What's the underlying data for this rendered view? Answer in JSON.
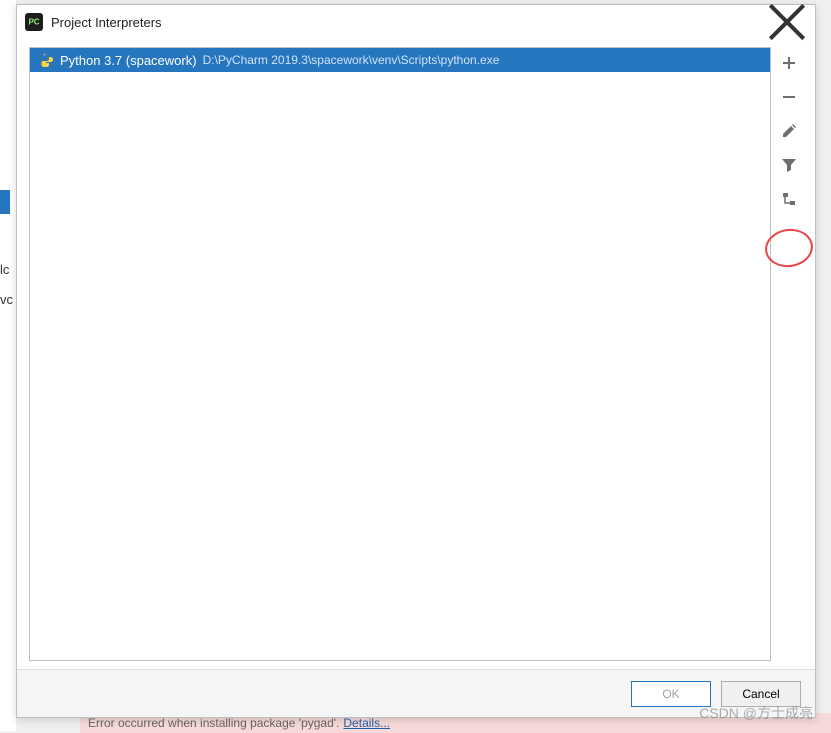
{
  "dialog": {
    "title": "Project Interpreters"
  },
  "interpreter": {
    "name": "Python 3.7 (spacework)",
    "path": "D:\\PyCharm 2019.3\\spacework\\venv\\Scripts\\python.exe"
  },
  "toolbar": {
    "add": "+",
    "remove": "−"
  },
  "buttons": {
    "ok": "OK",
    "cancel": "Cancel"
  },
  "error": {
    "message": "Error occurred when installing package 'pygad'.",
    "link": "Details..."
  },
  "background": {
    "snip1": "lc",
    "snip2": "vc"
  },
  "watermark": "CSDN @方士成亮"
}
